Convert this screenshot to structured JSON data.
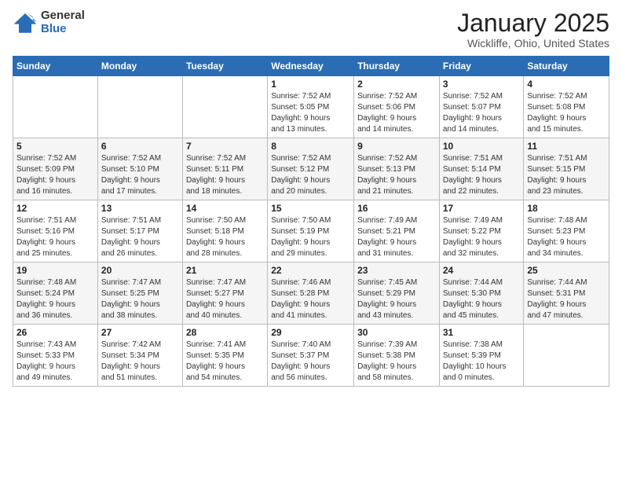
{
  "header": {
    "logo_general": "General",
    "logo_blue": "Blue",
    "title": "January 2025",
    "location": "Wickliffe, Ohio, United States"
  },
  "weekdays": [
    "Sunday",
    "Monday",
    "Tuesday",
    "Wednesday",
    "Thursday",
    "Friday",
    "Saturday"
  ],
  "weeks": [
    [
      {
        "day": "",
        "info": ""
      },
      {
        "day": "",
        "info": ""
      },
      {
        "day": "",
        "info": ""
      },
      {
        "day": "1",
        "info": "Sunrise: 7:52 AM\nSunset: 5:05 PM\nDaylight: 9 hours\nand 13 minutes."
      },
      {
        "day": "2",
        "info": "Sunrise: 7:52 AM\nSunset: 5:06 PM\nDaylight: 9 hours\nand 14 minutes."
      },
      {
        "day": "3",
        "info": "Sunrise: 7:52 AM\nSunset: 5:07 PM\nDaylight: 9 hours\nand 14 minutes."
      },
      {
        "day": "4",
        "info": "Sunrise: 7:52 AM\nSunset: 5:08 PM\nDaylight: 9 hours\nand 15 minutes."
      }
    ],
    [
      {
        "day": "5",
        "info": "Sunrise: 7:52 AM\nSunset: 5:09 PM\nDaylight: 9 hours\nand 16 minutes."
      },
      {
        "day": "6",
        "info": "Sunrise: 7:52 AM\nSunset: 5:10 PM\nDaylight: 9 hours\nand 17 minutes."
      },
      {
        "day": "7",
        "info": "Sunrise: 7:52 AM\nSunset: 5:11 PM\nDaylight: 9 hours\nand 18 minutes."
      },
      {
        "day": "8",
        "info": "Sunrise: 7:52 AM\nSunset: 5:12 PM\nDaylight: 9 hours\nand 20 minutes."
      },
      {
        "day": "9",
        "info": "Sunrise: 7:52 AM\nSunset: 5:13 PM\nDaylight: 9 hours\nand 21 minutes."
      },
      {
        "day": "10",
        "info": "Sunrise: 7:51 AM\nSunset: 5:14 PM\nDaylight: 9 hours\nand 22 minutes."
      },
      {
        "day": "11",
        "info": "Sunrise: 7:51 AM\nSunset: 5:15 PM\nDaylight: 9 hours\nand 23 minutes."
      }
    ],
    [
      {
        "day": "12",
        "info": "Sunrise: 7:51 AM\nSunset: 5:16 PM\nDaylight: 9 hours\nand 25 minutes."
      },
      {
        "day": "13",
        "info": "Sunrise: 7:51 AM\nSunset: 5:17 PM\nDaylight: 9 hours\nand 26 minutes."
      },
      {
        "day": "14",
        "info": "Sunrise: 7:50 AM\nSunset: 5:18 PM\nDaylight: 9 hours\nand 28 minutes."
      },
      {
        "day": "15",
        "info": "Sunrise: 7:50 AM\nSunset: 5:19 PM\nDaylight: 9 hours\nand 29 minutes."
      },
      {
        "day": "16",
        "info": "Sunrise: 7:49 AM\nSunset: 5:21 PM\nDaylight: 9 hours\nand 31 minutes."
      },
      {
        "day": "17",
        "info": "Sunrise: 7:49 AM\nSunset: 5:22 PM\nDaylight: 9 hours\nand 32 minutes."
      },
      {
        "day": "18",
        "info": "Sunrise: 7:48 AM\nSunset: 5:23 PM\nDaylight: 9 hours\nand 34 minutes."
      }
    ],
    [
      {
        "day": "19",
        "info": "Sunrise: 7:48 AM\nSunset: 5:24 PM\nDaylight: 9 hours\nand 36 minutes."
      },
      {
        "day": "20",
        "info": "Sunrise: 7:47 AM\nSunset: 5:25 PM\nDaylight: 9 hours\nand 38 minutes."
      },
      {
        "day": "21",
        "info": "Sunrise: 7:47 AM\nSunset: 5:27 PM\nDaylight: 9 hours\nand 40 minutes."
      },
      {
        "day": "22",
        "info": "Sunrise: 7:46 AM\nSunset: 5:28 PM\nDaylight: 9 hours\nand 41 minutes."
      },
      {
        "day": "23",
        "info": "Sunrise: 7:45 AM\nSunset: 5:29 PM\nDaylight: 9 hours\nand 43 minutes."
      },
      {
        "day": "24",
        "info": "Sunrise: 7:44 AM\nSunset: 5:30 PM\nDaylight: 9 hours\nand 45 minutes."
      },
      {
        "day": "25",
        "info": "Sunrise: 7:44 AM\nSunset: 5:31 PM\nDaylight: 9 hours\nand 47 minutes."
      }
    ],
    [
      {
        "day": "26",
        "info": "Sunrise: 7:43 AM\nSunset: 5:33 PM\nDaylight: 9 hours\nand 49 minutes."
      },
      {
        "day": "27",
        "info": "Sunrise: 7:42 AM\nSunset: 5:34 PM\nDaylight: 9 hours\nand 51 minutes."
      },
      {
        "day": "28",
        "info": "Sunrise: 7:41 AM\nSunset: 5:35 PM\nDaylight: 9 hours\nand 54 minutes."
      },
      {
        "day": "29",
        "info": "Sunrise: 7:40 AM\nSunset: 5:37 PM\nDaylight: 9 hours\nand 56 minutes."
      },
      {
        "day": "30",
        "info": "Sunrise: 7:39 AM\nSunset: 5:38 PM\nDaylight: 9 hours\nand 58 minutes."
      },
      {
        "day": "31",
        "info": "Sunrise: 7:38 AM\nSunset: 5:39 PM\nDaylight: 10 hours\nand 0 minutes."
      },
      {
        "day": "",
        "info": ""
      }
    ]
  ]
}
